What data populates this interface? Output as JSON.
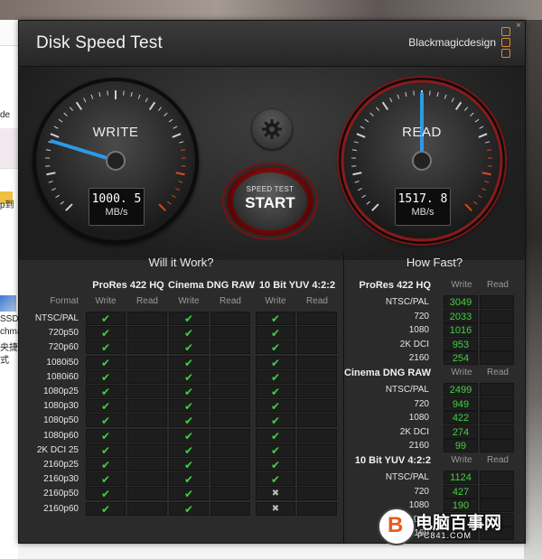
{
  "window": {
    "title": "Disk Speed Test",
    "brand": "Blackmagicdesign",
    "close_glyph": "×"
  },
  "background": {
    "left_texts": [
      "de",
      "SSD",
      "chma",
      "央捷",
      "式",
      "p到"
    ],
    "left_icon": "folder-icon"
  },
  "gauges": {
    "write": {
      "label": "WRITE",
      "value": "1000. 5",
      "unit": "MB/s",
      "needle_fraction": 0.23
    },
    "read": {
      "label": "READ",
      "value": "1517. 8",
      "unit": "MB/s",
      "needle_fraction": 0.5
    }
  },
  "controls": {
    "settings_icon": "gear-icon",
    "start_small": "SPEED TEST",
    "start_big": "START"
  },
  "will_it_work": {
    "title": "Will it Work?",
    "format_header": "Format",
    "write_header": "Write",
    "read_header": "Read",
    "groups": [
      "ProRes 422 HQ",
      "Cinema DNG RAW",
      "10 Bit YUV 4:2:2"
    ],
    "rows": [
      {
        "format": "NTSC/PAL",
        "marks": [
          "ok",
          "ok",
          "ok"
        ]
      },
      {
        "format": "720p50",
        "marks": [
          "ok",
          "ok",
          "ok"
        ]
      },
      {
        "format": "720p60",
        "marks": [
          "ok",
          "ok",
          "ok"
        ]
      },
      {
        "format": "1080i50",
        "marks": [
          "ok",
          "ok",
          "ok"
        ]
      },
      {
        "format": "1080i60",
        "marks": [
          "ok",
          "ok",
          "ok"
        ]
      },
      {
        "format": "1080p25",
        "marks": [
          "ok",
          "ok",
          "ok"
        ]
      },
      {
        "format": "1080p30",
        "marks": [
          "ok",
          "ok",
          "ok"
        ]
      },
      {
        "format": "1080p50",
        "marks": [
          "ok",
          "ok",
          "ok"
        ]
      },
      {
        "format": "1080p60",
        "marks": [
          "ok",
          "ok",
          "ok"
        ]
      },
      {
        "format": "2K DCI 25",
        "marks": [
          "ok",
          "ok",
          "ok"
        ]
      },
      {
        "format": "2160p25",
        "marks": [
          "ok",
          "ok",
          "ok"
        ]
      },
      {
        "format": "2160p30",
        "marks": [
          "ok",
          "ok",
          "ok"
        ]
      },
      {
        "format": "2160p50",
        "marks": [
          "ok",
          "ok",
          "no"
        ]
      },
      {
        "format": "2160p60",
        "marks": [
          "ok",
          "ok",
          "no"
        ]
      }
    ],
    "ok_glyph": "✔",
    "no_glyph": "✖"
  },
  "how_fast": {
    "title": "How Fast?",
    "write_header": "Write",
    "read_header": "Read",
    "groups": [
      {
        "name": "ProRes 422 HQ",
        "rows": [
          {
            "format": "NTSC/PAL",
            "write": "3049"
          },
          {
            "format": "720",
            "write": "2033"
          },
          {
            "format": "1080",
            "write": "1016"
          },
          {
            "format": "2K DCI",
            "write": "953"
          },
          {
            "format": "2160",
            "write": "254"
          }
        ]
      },
      {
        "name": "Cinema DNG RAW",
        "rows": [
          {
            "format": "NTSC/PAL",
            "write": "2499"
          },
          {
            "format": "720",
            "write": "949"
          },
          {
            "format": "1080",
            "write": "422"
          },
          {
            "format": "2K DCI",
            "write": "274"
          },
          {
            "format": "2160",
            "write": "99"
          }
        ]
      },
      {
        "name": "10 Bit YUV 4:2:2",
        "rows": [
          {
            "format": "NTSC/PAL",
            "write": "1124"
          },
          {
            "format": "720",
            "write": "427"
          },
          {
            "format": "1080",
            "write": "190"
          },
          {
            "format": "2K DCI",
            "write": ""
          },
          {
            "format": "2160",
            "write": ""
          }
        ]
      }
    ]
  },
  "watermark": {
    "logo_glyph": "B",
    "text": "电脑百事网",
    "url": "PC841.COM"
  },
  "colors": {
    "accent_green": "#3fd23f",
    "needle_blue": "#2b9ae6",
    "start_red": "#b51414",
    "gauge_red_zone": "#d94a1a"
  }
}
